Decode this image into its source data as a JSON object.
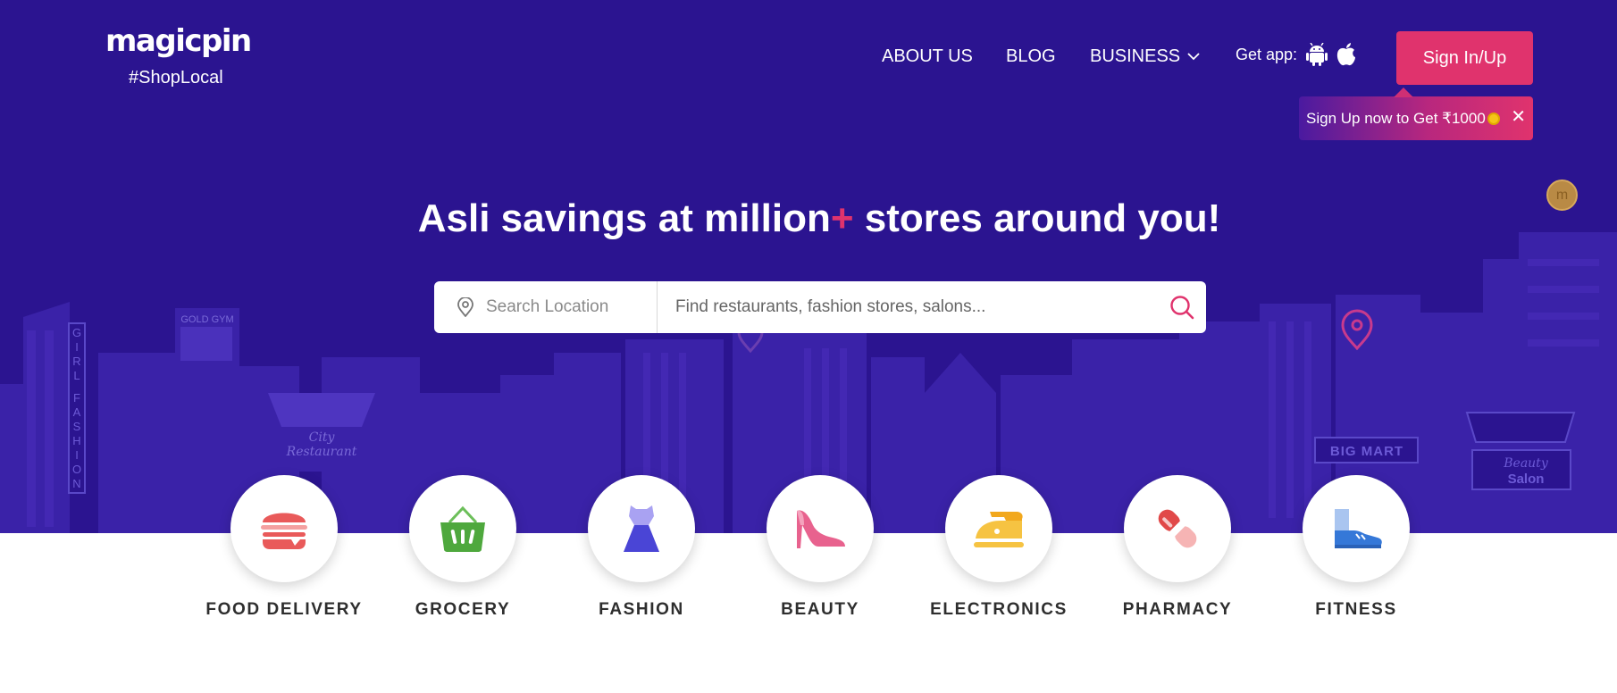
{
  "brand": {
    "logo": "magicpin",
    "tagline": "#ShopLocal"
  },
  "nav": {
    "about": "ABOUT US",
    "blog": "BLOG",
    "business": "BUSINESS",
    "get_app": "Get app:"
  },
  "auth": {
    "signin": "Sign In/Up",
    "promo": "Sign Up now to Get ₹1000",
    "close": "✕"
  },
  "hero": {
    "headline_pre": "Asli savings at million",
    "headline_plus": "+",
    "headline_post": " stores around you!",
    "float_coin": "m",
    "scene_text": {
      "gym": "GOLD GYM",
      "girl": [
        "G",
        "I",
        "R",
        "L"
      ],
      "fashion": [
        "F",
        "A",
        "S",
        "H",
        "I",
        "O",
        "N"
      ],
      "city": "City",
      "restaurant": "Restaurant",
      "bigmart": "BIG MART",
      "beauty": "Beauty",
      "salon": "Salon"
    }
  },
  "search": {
    "location_placeholder": "Search Location",
    "query_placeholder": "Find restaurants, fashion stores, salons..."
  },
  "categories": [
    {
      "label": "FOOD DELIVERY",
      "icon": "burger-icon"
    },
    {
      "label": "GROCERY",
      "icon": "basket-icon"
    },
    {
      "label": "FASHION",
      "icon": "dress-icon"
    },
    {
      "label": "BEAUTY",
      "icon": "heel-icon"
    },
    {
      "label": "ELECTRONICS",
      "icon": "iron-icon"
    },
    {
      "label": "PHARMACY",
      "icon": "capsule-icon"
    },
    {
      "label": "FITNESS",
      "icon": "shoe-icon"
    }
  ],
  "colors": {
    "hero_bg": "#2b1490",
    "accent": "#e0336d",
    "building": "#3a1fa6"
  }
}
